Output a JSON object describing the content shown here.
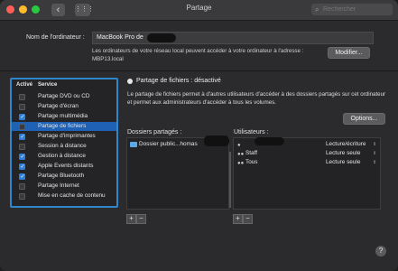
{
  "window": {
    "title": "Partage"
  },
  "toolbar": {
    "back": "‹",
    "forward": "›",
    "grid": "⋮⋮⋮",
    "search_placeholder": "Rechercher"
  },
  "computer": {
    "name_label": "Nom de l'ordinateur :",
    "name_value": "MacBook Pro de",
    "info": "Les ordinateurs de votre réseau local peuvent accéder à votre ordinateur à l'adresse :",
    "address": "MBP13.local",
    "modify_label": "Modifier..."
  },
  "services": {
    "header_active": "Activé",
    "header_service": "Service",
    "items": [
      {
        "label": "Partage DVD ou CD",
        "checked": false,
        "selected": false
      },
      {
        "label": "Partage d'écran",
        "checked": false,
        "selected": false
      },
      {
        "label": "Partage multimédia",
        "checked": true,
        "selected": false
      },
      {
        "label": "Partage de fichiers",
        "checked": false,
        "selected": true
      },
      {
        "label": "Partage d'imprimantes",
        "checked": true,
        "selected": false
      },
      {
        "label": "Session à distance",
        "checked": false,
        "selected": false
      },
      {
        "label": "Gestion à distance",
        "checked": true,
        "selected": false
      },
      {
        "label": "Apple Events distants",
        "checked": true,
        "selected": false
      },
      {
        "label": "Partage Bluetooth",
        "checked": true,
        "selected": false
      },
      {
        "label": "Partage Internet",
        "checked": false,
        "selected": false
      },
      {
        "label": "Mise en cache de contenu",
        "checked": false,
        "selected": false
      }
    ]
  },
  "file_sharing": {
    "status": "Partage de fichiers : désactivé",
    "description": "Le partage de fichiers permet à d'autres utilisateurs d'accéder à des dossiers partagés sur cet ordinateur et permet aux administrateurs d'accéder à tous les volumes.",
    "options_label": "Options..."
  },
  "shared_folders": {
    "title": "Dossiers partagés :",
    "items": [
      {
        "name": "Dossier public...homas"
      }
    ],
    "add": "+",
    "remove": "−"
  },
  "users": {
    "title": "Utilisateurs :",
    "items": [
      {
        "name": "",
        "permission": "Lecture/écriture"
      },
      {
        "name": "Staff",
        "permission": "Lecture seule"
      },
      {
        "name": "Tous",
        "permission": "Lecture seule"
      }
    ],
    "add": "+",
    "remove": "−"
  },
  "help": {
    "label": "?"
  }
}
